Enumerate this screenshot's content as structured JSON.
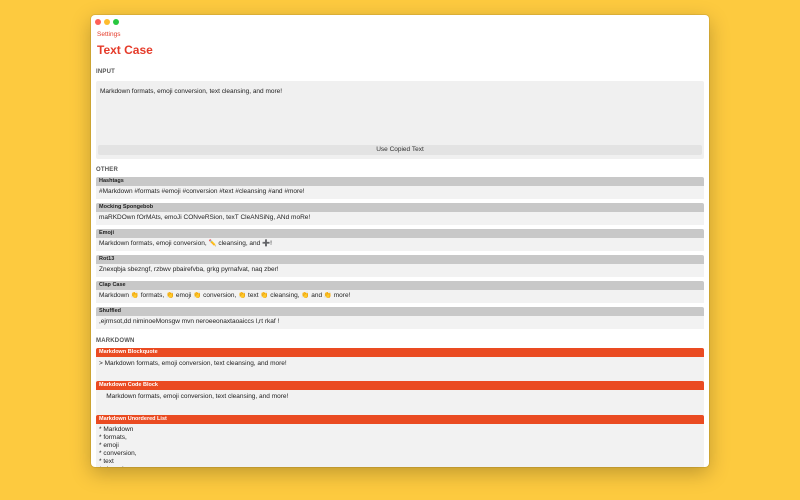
{
  "app": {
    "back_label": "Settings",
    "title": "Text Case"
  },
  "input": {
    "section_label": "INPUT",
    "value": "Markdown formats, emoji conversion, text cleansing, and more!",
    "use_copied_label": "Use Copied Text"
  },
  "other": {
    "section_label": "OTHER",
    "items": [
      {
        "title": "Hashtags",
        "value": "#Markdown #formats #emoji #conversion #text #cleansing #and #more!"
      },
      {
        "title": "Mocking Spongebob",
        "value": "maRKDOwn fOrMAts, emoJi CONveRSion, texT CleANSiNg, ANd moRe!"
      },
      {
        "title": "Emoji",
        "value": "Markdown formats, emoji conversion, ✏️ cleansing, and ➕!"
      },
      {
        "title": "Rot13",
        "value": "Znexqbja sbezngf, rzbwv pbairefvba, grkg pyrnafvat, naq zber!"
      },
      {
        "title": "Clap Case",
        "value": "Markdown 👏 formats, 👏 emoji 👏 conversion, 👏 text 👏 cleansing, 👏 and 👏 more!"
      },
      {
        "title": "Shuffled",
        "value": ",ejrmsot,dd niminoeMonsgw mvn neroeeonaxtaoaiccs l,rt rkaf !"
      }
    ]
  },
  "markdown": {
    "section_label": "MARKDOWN",
    "blockquote": {
      "title": "Markdown Blockquote",
      "value": "> Markdown formats, emoji conversion, text cleansing, and more!"
    },
    "codeblock": {
      "title": "Markdown Code Block",
      "value": "    Markdown formats, emoji conversion, text cleansing, and more!"
    },
    "unordered": {
      "title": "Markdown Unordered List",
      "value": "* Markdown\n* formats,\n* emoji\n* conversion,\n* text\n* cleansing,"
    }
  },
  "colors": {
    "accent": "#e53b2a",
    "markdown_header": "#ea4b22",
    "background": "#fdca3f"
  }
}
